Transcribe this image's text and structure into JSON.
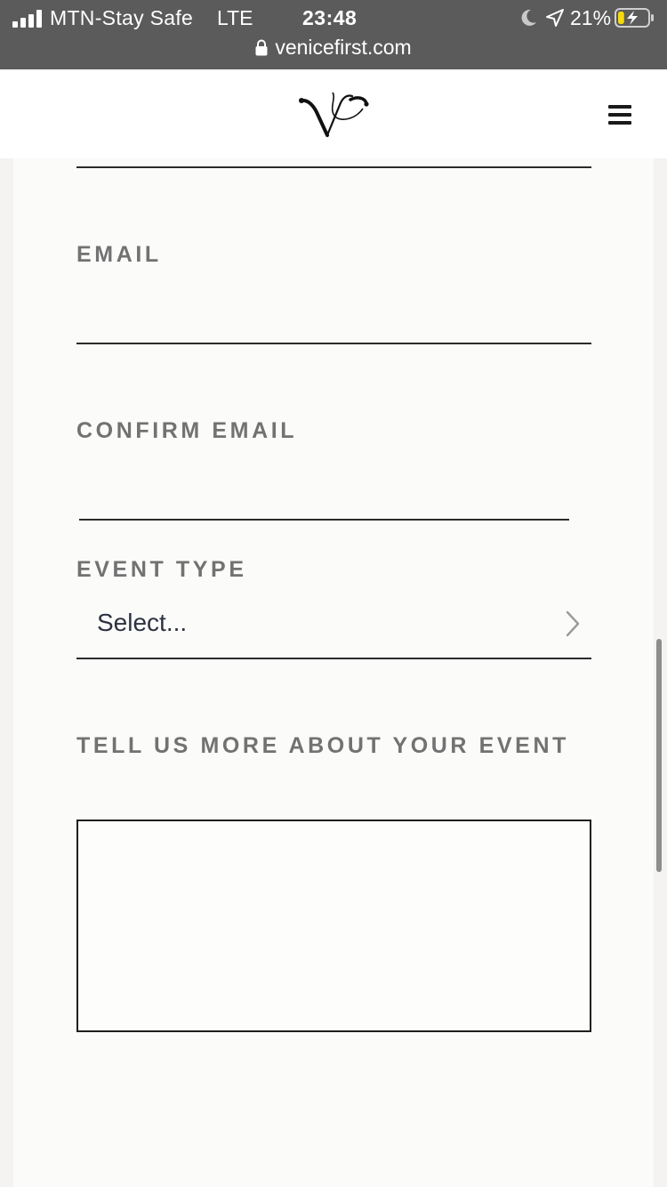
{
  "status_bar": {
    "carrier": "MTN-Stay Safe",
    "network": "LTE",
    "time": "23:48",
    "battery_percent": "21%",
    "battery_level": 0.21,
    "url": "venicefirst.com"
  },
  "header": {
    "logo_icon": "venicefirst-vf-monogram",
    "menu_icon": "hamburger-menu-icon"
  },
  "form": {
    "email_label": "EMAIL",
    "confirm_email_label": "CONFIRM EMAIL",
    "event_type_label": "EVENT TYPE",
    "event_type_value": "Select...",
    "event_details_label": "TELL US MORE ABOUT YOUR EVENT"
  },
  "colors": {
    "status_bar_bg": "#5b5b5b",
    "label_text": "#727272",
    "battery_fill": "#f5d90a"
  }
}
